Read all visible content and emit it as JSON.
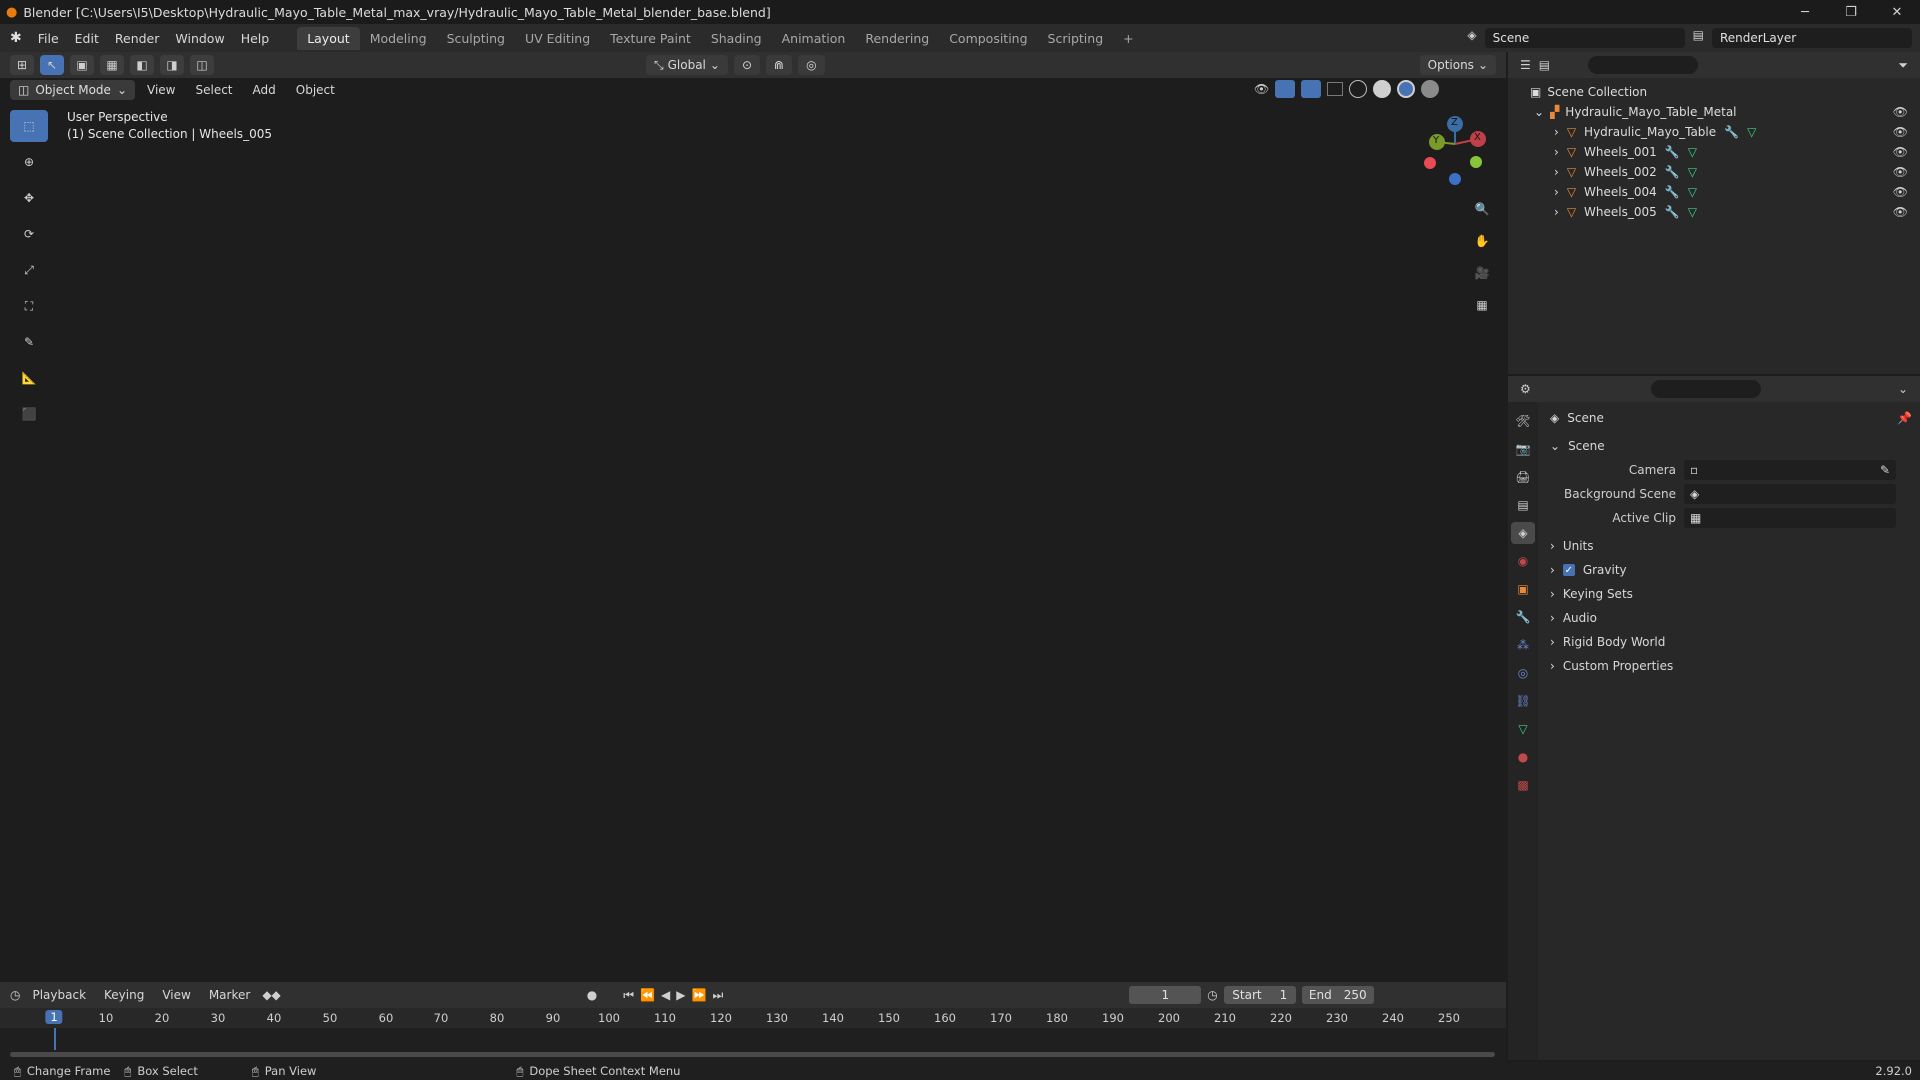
{
  "window": {
    "title": "Blender [C:\\Users\\I5\\Desktop\\Hydraulic_Mayo_Table_Metal_max_vray/Hydraulic_Mayo_Table_Metal_blender_base.blend]",
    "minimize": "─",
    "maximize": "❐",
    "close": "✕"
  },
  "menubar": {
    "items": [
      "File",
      "Edit",
      "Render",
      "Window",
      "Help"
    ],
    "workspaces": [
      "Layout",
      "Modeling",
      "Sculpting",
      "UV Editing",
      "Texture Paint",
      "Shading",
      "Animation",
      "Rendering",
      "Compositing",
      "Scripting"
    ],
    "active_workspace": "Layout",
    "add_tab": "+",
    "scene": "Scene",
    "view_layer": "RenderLayer"
  },
  "viewport_header": {
    "transform_orientation": "Global",
    "options": "Options",
    "mode": "Object Mode",
    "menus": [
      "View",
      "Select",
      "Add",
      "Object"
    ]
  },
  "viewport": {
    "perspective": "User Perspective",
    "collection_info": "(1) Scene Collection | Wheels_005",
    "colors": {
      "background": "#3a3a3a",
      "x_axis": "#c0404a",
      "y_axis": "#7a9a2c"
    }
  },
  "toolbar": {
    "tools": [
      "select-box-icon",
      "cursor-icon",
      "move-icon",
      "rotate-icon",
      "scale-icon",
      "transform-icon",
      "annotate-icon",
      "measure-icon",
      "add-cube-icon"
    ]
  },
  "gizmo": {
    "z": "Z",
    "y": "Y",
    "x": "X"
  },
  "outliner": {
    "root": "Scene Collection",
    "collection": "Hydraulic_Mayo_Table_Metal",
    "objects": [
      "Hydraulic_Mayo_Table",
      "Wheels_001",
      "Wheels_002",
      "Wheels_004",
      "Wheels_005"
    ],
    "eye": "👁"
  },
  "properties": {
    "header_title": "Scene",
    "panel_title": "Scene",
    "fields": [
      {
        "label": "Camera",
        "value": ""
      },
      {
        "label": "Background Scene",
        "value": ""
      },
      {
        "label": "Active Clip",
        "value": ""
      }
    ],
    "panels": [
      "Units",
      "Gravity",
      "Keying Sets",
      "Audio",
      "Rigid Body World",
      "Custom Properties"
    ],
    "gravity_checked": true
  },
  "timeline": {
    "menus": [
      "Playback",
      "Keying",
      "View",
      "Marker"
    ],
    "current_frame": "1",
    "start_label": "Start",
    "start": "1",
    "end_label": "End",
    "end": "250",
    "ticks": [
      "10",
      "20",
      "30",
      "40",
      "50",
      "60",
      "70",
      "80",
      "90",
      "100",
      "110",
      "120",
      "130",
      "140",
      "150",
      "160",
      "170",
      "180",
      "190",
      "200",
      "210",
      "220",
      "230",
      "240",
      "250"
    ],
    "ruler_current": "1"
  },
  "statusbar": {
    "change_frame": "Change Frame",
    "box_select": "Box Select",
    "pan_view": "Pan View",
    "context_menu": "Dope Sheet Context Menu",
    "version": "2.92.0"
  }
}
